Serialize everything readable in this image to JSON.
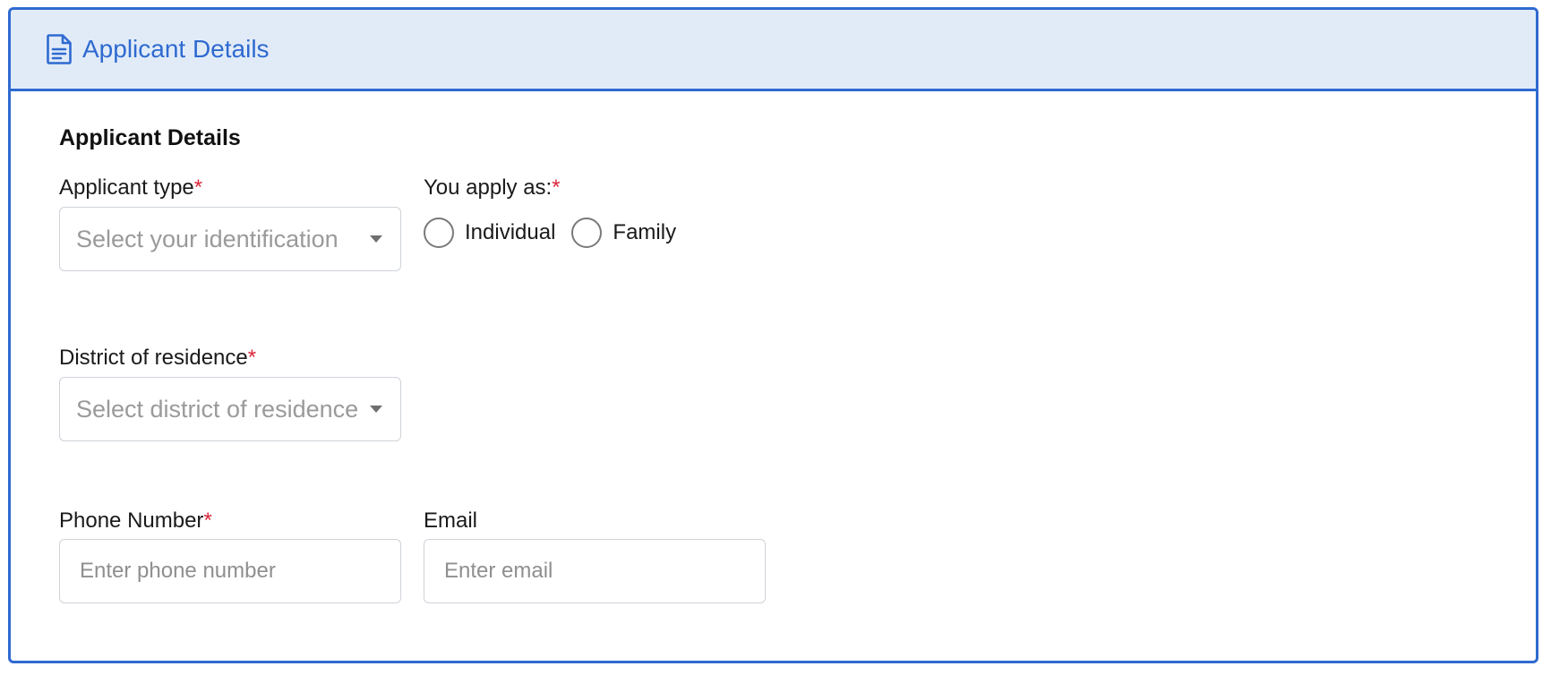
{
  "header": {
    "title": "Applicant Details",
    "icon": "document-icon",
    "accent_color": "#2f6ad0",
    "background_color": "#e1ebf8"
  },
  "section": {
    "title": "Applicant Details"
  },
  "fields": {
    "applicant_type": {
      "label": "Applicant type",
      "required_mark": "*",
      "placeholder": "Select your identification"
    },
    "apply_as": {
      "label": "You apply as:",
      "required_mark": "*",
      "options": [
        "Individual",
        "Family"
      ]
    },
    "district": {
      "label": "District of residence",
      "required_mark": "*",
      "placeholder": "Select district of residence"
    },
    "phone": {
      "label": "Phone Number",
      "required_mark": "*",
      "placeholder": "Enter phone number"
    },
    "email": {
      "label": "Email",
      "placeholder": "Enter email"
    }
  },
  "colors": {
    "required": "#d9263a",
    "placeholder": "#9a9a9a"
  }
}
